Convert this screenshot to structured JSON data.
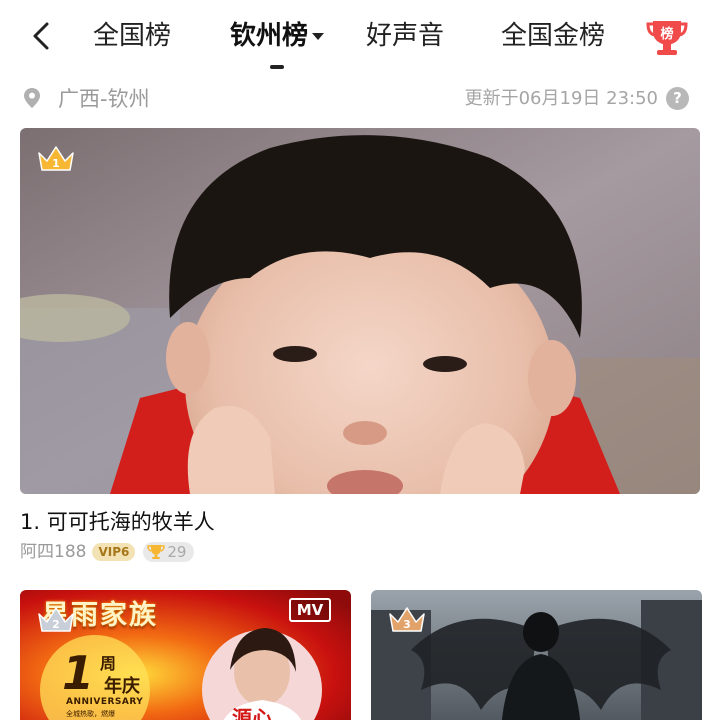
{
  "nav": {
    "tabs": [
      {
        "label": "全国榜",
        "active": false
      },
      {
        "label": "钦州榜",
        "active": true
      },
      {
        "label": "好声音",
        "active": false
      },
      {
        "label": "全国金榜",
        "active": false
      }
    ],
    "badge_text": "榜"
  },
  "location": {
    "label": "广西-钦州",
    "updated": "更新于06月19日 23:50",
    "help": "?"
  },
  "entries": [
    {
      "rank": "1",
      "title": "1. 可可托海的牧羊人",
      "author": "阿四188",
      "vip": "VIP6",
      "cups": "29"
    },
    {
      "rank": "2",
      "banner": "星雨家族",
      "mv": "MV",
      "anniversary_num": "1",
      "anniversary_zhou": "周",
      "anniversary_qing": "年庆",
      "anniversary_en": "ANNIVERSARY",
      "anniversary_sub": "全城热歌，燃爆",
      "name": "源心"
    },
    {
      "rank": "3"
    }
  ],
  "icons": {
    "back": "chevron-left-icon",
    "dropdown": "caret-down-icon",
    "trophy": "trophy-badge-icon",
    "location": "location-pin-icon",
    "crown": "crown-icon",
    "cup": "trophy-cup-icon"
  },
  "colors": {
    "badge_red": "#f14a4a",
    "crown_gold": "#f7b733",
    "vip_bg": "#f3e2b4",
    "vip_text": "#a67718"
  }
}
